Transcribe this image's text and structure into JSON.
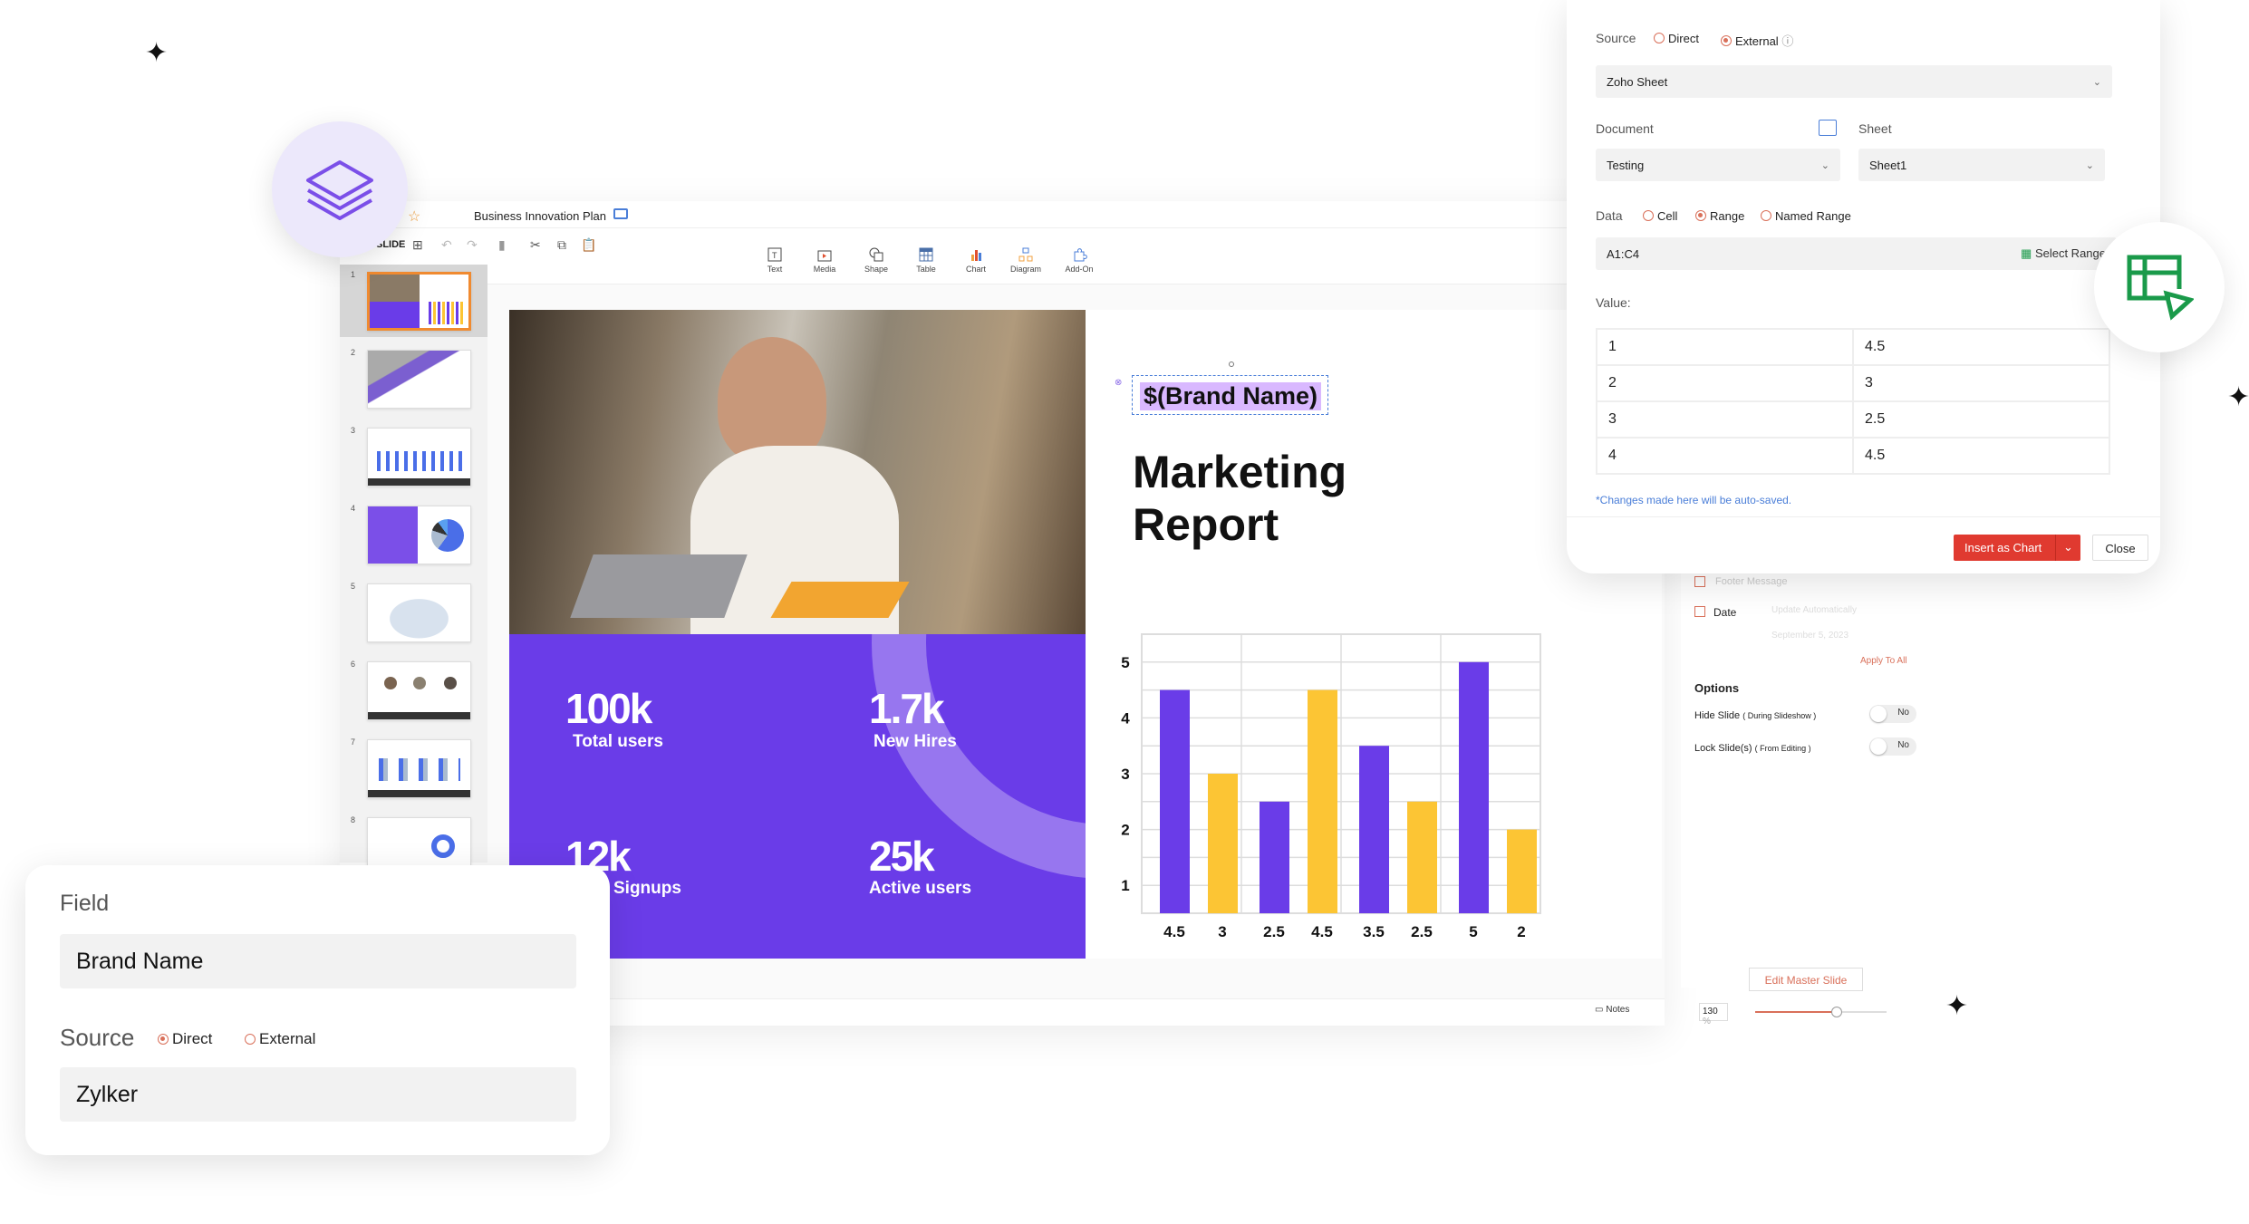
{
  "app": {
    "document_title": "Business Innovation Plan",
    "slide_menu": "SLIDE",
    "insert_tools": [
      "Text",
      "Media",
      "Shape",
      "Table",
      "Chart",
      "Diagram",
      "Add-On"
    ],
    "slide_count_visible": 8
  },
  "slide": {
    "placeholder": "$(Brand Name)",
    "title_line1": "Marketing",
    "title_line2": "Report",
    "stats": [
      {
        "value": "100k",
        "label": "Total users"
      },
      {
        "value": "1.7k",
        "label": "New Hires"
      },
      {
        "value": "12k",
        "label": "Signups"
      },
      {
        "value": "25k",
        "label": "Active users"
      }
    ]
  },
  "chart_data": {
    "type": "bar",
    "categories": [
      "4.5",
      "3",
      "2.5",
      "4.5",
      "3.5",
      "2.5",
      "5",
      "2"
    ],
    "series": [
      {
        "values": [
          4.5,
          2.5,
          3.5,
          5
        ],
        "color": "#6a3ce8"
      },
      {
        "values": [
          3,
          4.5,
          2.5,
          2
        ],
        "color": "#fcc534"
      }
    ],
    "y_ticks": [
      1,
      2,
      3,
      4,
      5
    ],
    "ylim": [
      0.5,
      5.5
    ],
    "grid": true
  },
  "data_panel": {
    "source_label": "Source",
    "source_options": [
      "Direct",
      "External"
    ],
    "source_selected": "External",
    "provider": "Zoho Sheet",
    "document_label": "Document",
    "document_value": "Testing",
    "sheet_label": "Sheet",
    "sheet_value": "Sheet1",
    "data_label": "Data",
    "data_options": [
      "Cell",
      "Range",
      "Named Range"
    ],
    "data_selected": "Range",
    "range_value": "A1:C4",
    "select_range": "Select Range",
    "value_label": "Value:",
    "values": [
      [
        "1",
        "4.5"
      ],
      [
        "2",
        "3"
      ],
      [
        "3",
        "2.5"
      ],
      [
        "4",
        "4.5"
      ]
    ],
    "note": "*Changes made here will be auto-saved.",
    "insert_button": "Insert as Chart",
    "close_button": "Close"
  },
  "props": {
    "footer_message": "Footer Message",
    "date_label": "Date",
    "date_mode": "Update Automatically",
    "date_value": "September 5, 2023",
    "apply_all": "Apply To All",
    "options_title": "Options",
    "hide_slide": "Hide Slide",
    "hide_slide_hint": "( During Slideshow )",
    "hide_value": "No",
    "lock_slide": "Lock Slide(s)",
    "lock_slide_hint": "( From Editing )",
    "lock_value": "No",
    "edit_master": "Edit Master Slide"
  },
  "statusbar": {
    "notes": "Notes",
    "zoom": "130",
    "zoom_unit": "%",
    "zoom_level": 0.6
  },
  "field_card": {
    "field_label": "Field",
    "field_value": "Brand Name",
    "source_label": "Source",
    "source_options": [
      "Direct",
      "External"
    ],
    "source_selected": "Direct",
    "source_value": "Zylker"
  },
  "colors": {
    "accent": "#6a3ce8",
    "yellow": "#fcc534",
    "red": "#e03a30",
    "green": "#1a9a4a"
  }
}
